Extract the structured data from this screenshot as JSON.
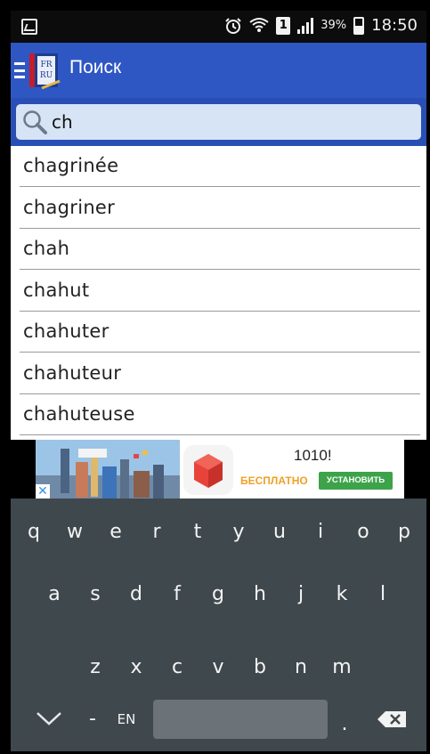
{
  "status_bar": {
    "battery_percent": "39%",
    "sim_label": "1",
    "time": "18:50"
  },
  "app_bar": {
    "title": "Поиск",
    "logo_top_text": "FR",
    "logo_bottom_text": "RU"
  },
  "search": {
    "value": "ch",
    "placeholder": ""
  },
  "results": [
    "chagrinée",
    "chagriner",
    "chah",
    "chahut",
    "chahuter",
    "chahuteur",
    "chahuteuse"
  ],
  "ad": {
    "title": "1010!",
    "free_label": "БЕСПЛАТНО",
    "install_label": "УСТАНОВИТЬ",
    "close_label": "✕"
  },
  "keyboard": {
    "row1": [
      "q",
      "w",
      "e",
      "r",
      "t",
      "y",
      "u",
      "i",
      "o",
      "p"
    ],
    "row2": [
      "a",
      "s",
      "d",
      "f",
      "g",
      "h",
      "j",
      "k",
      "l"
    ],
    "row3": [
      "z",
      "x",
      "c",
      "v",
      "b",
      "n",
      "m"
    ],
    "dash_label": "-",
    "lang_label": "EN",
    "period_label": "."
  },
  "colors": {
    "app_bar": "#2f57c4",
    "search_bg": "#d7e4f6",
    "keyboard_bg": "#3f484d",
    "install_green": "#3da34a",
    "free_orange": "#f0a028"
  }
}
